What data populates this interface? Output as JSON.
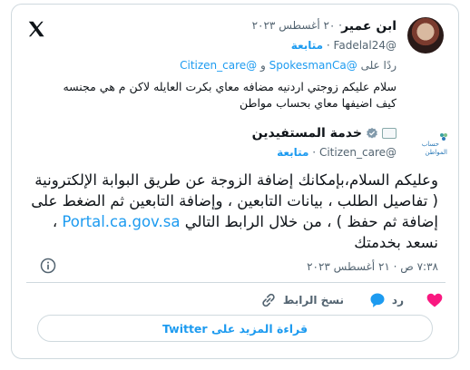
{
  "tweet": {
    "author_name": "ابن عمير",
    "date": "٢٠ أغسطس ٢٠٢٣",
    "handle": "@Fadelal24",
    "follow_label": "متابعة",
    "reply_prefix": "ردًا على",
    "reply_mention_1": "@SpokesmanCa",
    "reply_and": "و",
    "reply_mention_2": "@Citizen_care",
    "text_line1": "سلام عليكم  زوجتي اردنيه مضافه معاي بكرت العايله لاكن م هي مجنسه",
    "text_line2": "كيف اضيفها معاي بحساب مواطن"
  },
  "reply": {
    "author_name": "خدمة المستفيدين",
    "handle": "@Citizen_care",
    "follow_label": "متابعة",
    "logo_line1": "حساب",
    "logo_line2": "المواطن",
    "text": "وعليكم السلام،بإمكانك إضافة الزوجة عن طريق البوابة الإلكترونية ( تفاصيل الطلب ، بيانات التابعين ، وإضافة التابعين ثم الضغط على إضافة ثم حفظ ) ، من خلال الرابط التالي",
    "link": "Portal.ca.gov.sa",
    "closing": "، نسعد بخدمتك",
    "timestamp": "٧:٣٨ ص · ٢١ أغسطس ٢٠٢٣"
  },
  "actions": {
    "reply_label": "رد",
    "copy_link_label": "نسخ الرابط"
  },
  "read_more_label": "قراءة المزيد على Twitter",
  "colors": {
    "accent": "#1d9bf0",
    "text": "#0f1419",
    "muted": "#536471",
    "heart": "#f91880"
  }
}
